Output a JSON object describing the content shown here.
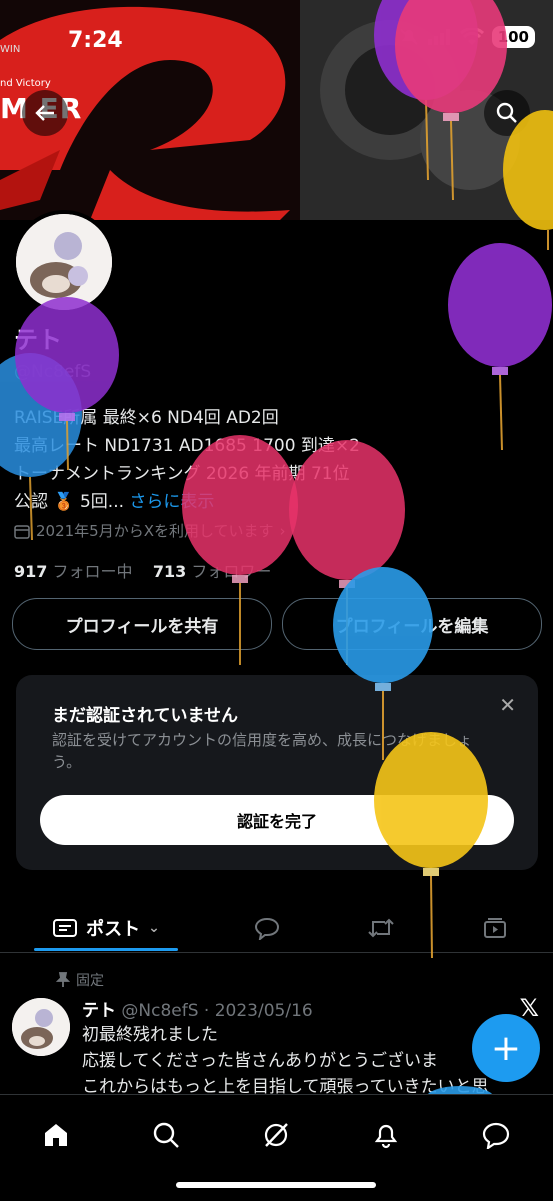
{
  "status_bar": {
    "time": "7:24",
    "battery": "100"
  },
  "banner": {
    "small_text": "nd Victory",
    "win_text": "WIN",
    "big_text": "M  ER"
  },
  "profile": {
    "name": "テト",
    "handle": "@Nc8efS",
    "bio_lines": [
      "RAISE所属 最終×6 ND4回 AD2回",
      "最高レート ND1731 AD1685 1700 到達×2",
      "トーナメントランキング 2026 年前期 71位",
      "公認 🥉 5回..."
    ],
    "show_more": "さらに表示",
    "joined": "2021年5月からXを利用しています",
    "following_count": "917",
    "following_label": "フォロー中",
    "followers_count": "713",
    "followers_label": "フォロワー"
  },
  "actions": {
    "share": "プロフィールを共有",
    "edit": "プロフィールを編集"
  },
  "verify_card": {
    "title": "まだ認証されていません",
    "description": "認証を受けてアカウントの信用度を高め、成長につなげましょう。",
    "button": "認証を完了"
  },
  "tabs": {
    "posts": "ポスト"
  },
  "post": {
    "pinned_label": "固定",
    "name": "テト",
    "meta": "@Nc8efS · 2023/05/16",
    "lines": [
      "初最終残れました",
      "応援してくださった皆さんありがとうございま",
      "これからはもっと上を目指して頑張っていきたいと思"
    ]
  },
  "colors": {
    "accent": "#1d9bf0",
    "background": "#000000"
  },
  "icons": [
    "back-arrow-icon",
    "search-icon",
    "calendar-icon",
    "close-icon",
    "pin-icon",
    "x-logo-icon",
    "home-icon",
    "grok-icon",
    "bell-icon",
    "chat-icon",
    "plus-icon"
  ]
}
